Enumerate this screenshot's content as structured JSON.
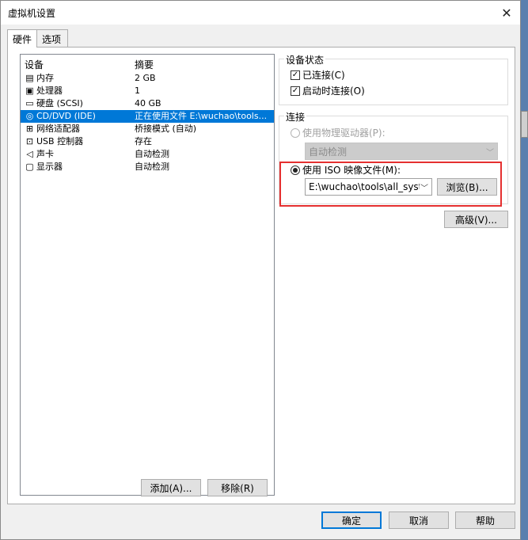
{
  "window": {
    "title": "虚拟机设置",
    "close_glyph": "✕"
  },
  "tabs": [
    {
      "label": "硬件",
      "active": true
    },
    {
      "label": "选项",
      "active": false
    }
  ],
  "device_list": {
    "headers": [
      "设备",
      "摘要"
    ],
    "rows": [
      {
        "icon": "memory-icon",
        "glyph": "▤",
        "device": "内存",
        "summary": "2 GB",
        "selected": false
      },
      {
        "icon": "processor-icon",
        "glyph": "▣",
        "device": "处理器",
        "summary": "1",
        "selected": false
      },
      {
        "icon": "hard-disk-icon",
        "glyph": "▭",
        "device": "硬盘 (SCSI)",
        "summary": "40 GB",
        "selected": false
      },
      {
        "icon": "cd-dvd-icon",
        "glyph": "◎",
        "device": "CD/DVD (IDE)",
        "summary": "正在使用文件 E:\\wuchao\\tools...",
        "selected": true
      },
      {
        "icon": "network-adapter-icon",
        "glyph": "⊞",
        "device": "网络适配器",
        "summary": "桥接模式 (自动)",
        "selected": false
      },
      {
        "icon": "usb-controller-icon",
        "glyph": "⊡",
        "device": "USB 控制器",
        "summary": "存在",
        "selected": false
      },
      {
        "icon": "sound-card-icon",
        "glyph": "◁",
        "device": "声卡",
        "summary": "自动检测",
        "selected": false
      },
      {
        "icon": "display-icon",
        "glyph": "▢",
        "device": "显示器",
        "summary": "自动检测",
        "selected": false
      }
    ],
    "add_label": "添加(A)...",
    "remove_label": "移除(R)"
  },
  "device_status": {
    "legend": "设备状态",
    "connected_label": "已连接(C)",
    "connected_checked": true,
    "connect_on_power_label": "启动时连接(O)",
    "connect_on_power_checked": true
  },
  "connection": {
    "legend": "连接",
    "physical_label": "使用物理驱动器(P):",
    "physical_selected": false,
    "physical_combo_value": "自动检测",
    "iso_label": "使用 ISO 映像文件(M):",
    "iso_selected": true,
    "iso_path": "E:\\wuchao\\tools\\all_systems",
    "browse_label": "浏览(B)...",
    "advanced_label": "高级(V)..."
  },
  "footer": {
    "ok_label": "确定",
    "cancel_label": "取消",
    "help_label": "帮助"
  },
  "colors": {
    "selection": "#0078d7",
    "highlight_box": "#e53030",
    "desktop": "#3a6ea5"
  }
}
